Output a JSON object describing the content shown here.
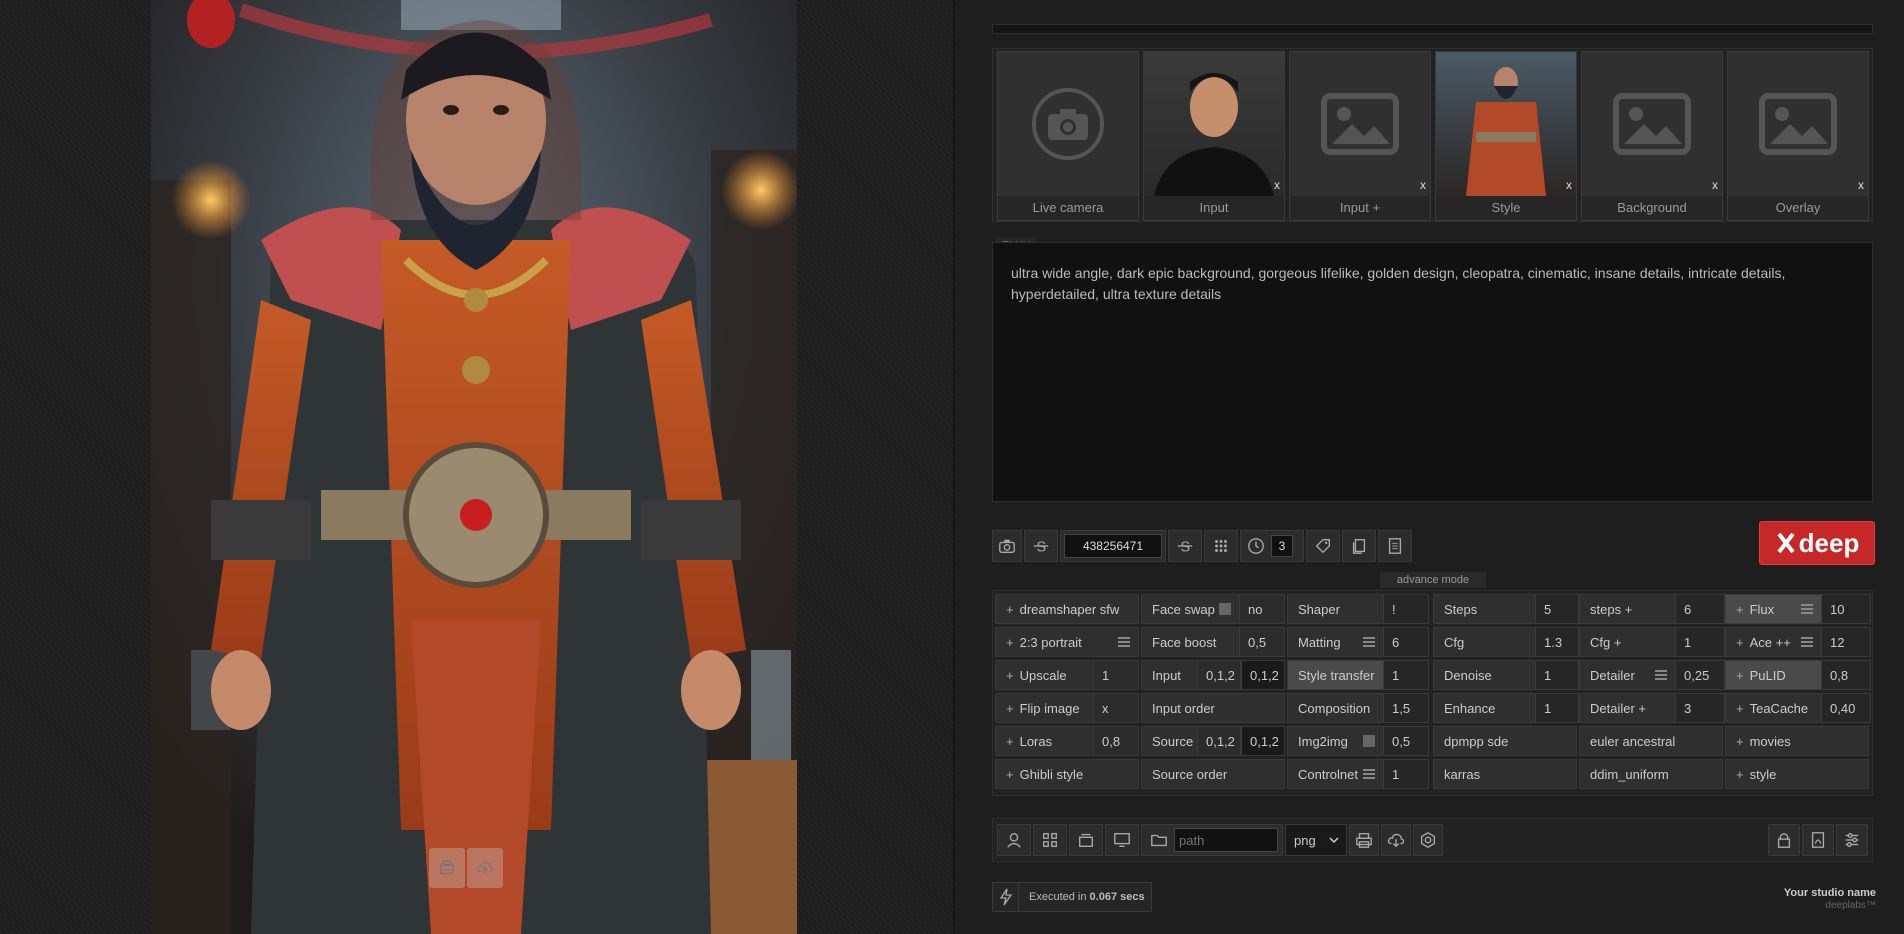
{
  "viewer": {
    "save_icon": "save-icon",
    "cloud_icon": "cloud-upload-icon"
  },
  "sources": [
    {
      "label": "Live camera",
      "icon": "camera-icon",
      "has_close": false
    },
    {
      "label": "Input",
      "icon": "person-photo",
      "has_close": true
    },
    {
      "label": "Input +",
      "icon": "image-placeholder-icon",
      "has_close": true
    },
    {
      "label": "Style",
      "icon": "style-photo",
      "has_close": true
    },
    {
      "label": "Background",
      "icon": "image-placeholder-icon",
      "has_close": true
    },
    {
      "label": "Overlay",
      "icon": "image-placeholder-icon",
      "has_close": true
    }
  ],
  "close_label": "x",
  "prompt": {
    "model_tag": "FLUX",
    "text": "ultra wide angle, dark epic background, gorgeous lifelike, golden design, cleopatra, cinematic, insane details, intricate details, hyperdetailed, ultra texture details"
  },
  "toolbar": {
    "seed": "438256471",
    "batch": "3"
  },
  "brand": {
    "label": "deep",
    "color": "#c62828"
  },
  "advance_mode_label": "advance mode",
  "grid": {
    "col1": [
      {
        "name": "dreamshaper sfw",
        "plus": true,
        "value": "",
        "menu": false
      },
      {
        "name": "2:3 portrait",
        "plus": true,
        "value": "",
        "menu": true
      },
      {
        "name": "Upscale",
        "plus": true,
        "value": "1",
        "menu": false
      },
      {
        "name": "Flip image",
        "plus": true,
        "value": "x",
        "menu": false
      },
      {
        "name": "Loras",
        "plus": true,
        "value": "0,8",
        "menu": false
      },
      {
        "name": "Ghibli style",
        "plus": true,
        "value": "",
        "menu": false
      }
    ],
    "col2": [
      {
        "name": "Face swap",
        "value": "no",
        "check": true
      },
      {
        "name": "Face boost",
        "value": "0,5"
      },
      {
        "name": "Input",
        "value": "0,1,2",
        "value2": "0,1,2"
      },
      {
        "name": "Input order",
        "value": ""
      },
      {
        "name": "Source",
        "value": "0,1,2",
        "value2": "0,1,2"
      },
      {
        "name": "Source order",
        "value": ""
      }
    ],
    "col3": [
      {
        "name": "Shaper",
        "value": "!",
        "menu": false
      },
      {
        "name": "Matting",
        "value": "6",
        "menu": true
      },
      {
        "name": "Style transfer",
        "value": "1",
        "menu": false,
        "highlight": true
      },
      {
        "name": "Composition",
        "value": "1,5",
        "menu": false
      },
      {
        "name": "Img2img",
        "value": "0,5",
        "check": true
      },
      {
        "name": "Controlnet",
        "value": "1",
        "menu": true
      }
    ],
    "col4": [
      {
        "name": "Steps",
        "value": "5"
      },
      {
        "name": "Cfg",
        "value": "1.3"
      },
      {
        "name": "Denoise",
        "value": "1"
      },
      {
        "name": "Enhance",
        "value": "1"
      },
      {
        "name": "dpmpp sde",
        "value": ""
      },
      {
        "name": "karras",
        "value": ""
      }
    ],
    "col5": [
      {
        "name": "steps +",
        "value": "6",
        "menu": false
      },
      {
        "name": "Cfg +",
        "value": "1",
        "menu": false
      },
      {
        "name": "Detailer",
        "value": "0,25",
        "menu": true
      },
      {
        "name": "Detailer +",
        "value": "3",
        "menu": false
      },
      {
        "name": "euler ancestral",
        "value": "",
        "menu": false
      },
      {
        "name": "ddim_uniform",
        "value": "",
        "menu": false
      }
    ],
    "col6": [
      {
        "name": "Flux",
        "value": "10",
        "menu": true,
        "highlight": true
      },
      {
        "name": "Ace ++",
        "value": "12",
        "menu": true
      },
      {
        "name": "PuLID",
        "value": "0,8",
        "menu": false,
        "highlight": true
      },
      {
        "name": "TeaCache",
        "value": "0,40",
        "menu": false
      },
      {
        "name": "movies",
        "value": "",
        "menu": false
      },
      {
        "name": "style",
        "value": "",
        "menu": false
      }
    ]
  },
  "bottom": {
    "path_placeholder": "path",
    "format": "png",
    "format_options": [
      "png"
    ]
  },
  "status": {
    "prefix": "Executed in ",
    "time": "0.067 secs"
  },
  "footer": {
    "studio_name": "Your studio name",
    "sub": "deeplabs™"
  }
}
